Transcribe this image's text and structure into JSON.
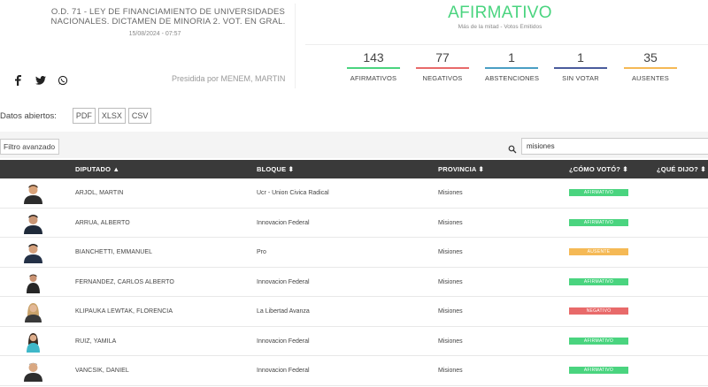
{
  "header": {
    "title": "O.D. 71 - LEY DE FINANCIAMIENTO DE UNIVERSIDADES NACIONALES. DICTAMEN DE MINORIA 2. VOT. EN GRAL.",
    "date": "15/08/2024 - 07:57",
    "presidida": "Presidida por MENEM, MARTIN",
    "social_icons": [
      "facebook-icon",
      "twitter-icon",
      "whatsapp-icon"
    ]
  },
  "result": {
    "label": "AFIRMATIVO",
    "subtitle": "Más de la mitad - Votos Emitidos",
    "color": "#4ad47f"
  },
  "stats": [
    {
      "value": "143",
      "label": "AFIRMATIVOS",
      "color": "#4ad47f"
    },
    {
      "value": "77",
      "label": "NEGATIVOS",
      "color": "#e86a6a"
    },
    {
      "value": "1",
      "label": "ABSTENCIONES",
      "color": "#4a9fc4"
    },
    {
      "value": "1",
      "label": "SIN VOTAR",
      "color": "#4a5c9c"
    },
    {
      "value": "35",
      "label": "AUSENTES",
      "color": "#f5b955"
    }
  ],
  "datos": {
    "label": "Datos abiertos:",
    "formats": [
      "PDF",
      "XLSX",
      "CSV"
    ]
  },
  "toolbar": {
    "filtro_label": "Filtro avanzado",
    "search_value": "misiones"
  },
  "table": {
    "headers": {
      "diputado": "DIPUTADO",
      "bloque": "BLOQUE",
      "provincia": "PROVINCIA",
      "voto": "¿CÓMO VOTÓ?",
      "dijo": "¿QUÉ DIJO?"
    },
    "rows": [
      {
        "name": "ARJOL, MARTIN",
        "bloque": "Ucr - Union Civica Radical",
        "provincia": "Misiones",
        "voto": "AFIRMATIVO",
        "color": "#4ad47f"
      },
      {
        "name": "ARRUA, ALBERTO",
        "bloque": "Innovacion Federal",
        "provincia": "Misiones",
        "voto": "AFIRMATIVO",
        "color": "#4ad47f"
      },
      {
        "name": "BIANCHETTI, EMMANUEL",
        "bloque": "Pro",
        "provincia": "Misiones",
        "voto": "AUSENTE",
        "color": "#f5b955"
      },
      {
        "name": "FERNANDEZ, CARLOS ALBERTO",
        "bloque": "Innovacion Federal",
        "provincia": "Misiones",
        "voto": "AFIRMATIVO",
        "color": "#4ad47f"
      },
      {
        "name": "KLIPAUKA LEWTAK, FLORENCIA",
        "bloque": "La Libertad Avanza",
        "provincia": "Misiones",
        "voto": "NEGATIVO",
        "color": "#e86a6a"
      },
      {
        "name": "RUIZ, YAMILA",
        "bloque": "Innovacion Federal",
        "provincia": "Misiones",
        "voto": "AFIRMATIVO",
        "color": "#4ad47f"
      },
      {
        "name": "VANCSIK, DANIEL",
        "bloque": "Innovacion Federal",
        "provincia": "Misiones",
        "voto": "AFIRMATIVO",
        "color": "#4ad47f"
      }
    ]
  }
}
